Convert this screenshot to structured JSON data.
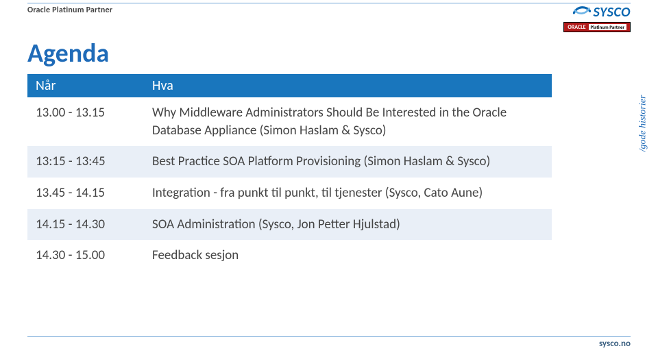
{
  "header": {
    "tagline": "Oracle Platinum Partner",
    "logo_text": "SYSCO",
    "oracle_badge_left": "ORACLE",
    "oracle_badge_right": "Platinum Partner"
  },
  "title": "Agenda",
  "table": {
    "columns": {
      "when": "Når",
      "what": "Hva"
    },
    "rows": [
      {
        "when": "13.00 - 13.15",
        "what": "Why Middleware Administrators Should Be Interested in the Oracle Database Appliance (Simon Haslam & Sysco)"
      },
      {
        "when": "13:15 - 13:45",
        "what": "Best Practice SOA Platform Provisioning (Simon Haslam & Sysco)"
      },
      {
        "when": "13.45 - 14.15",
        "what": "Integration - fra punkt til punkt, til tjenester (Sysco, Cato Aune)"
      },
      {
        "when": "14.15 - 14.30",
        "what": "SOA Administration (Sysco, Jon Petter Hjulstad)"
      },
      {
        "when": "14.30 - 15.00",
        "what": "Feedback sesjon"
      }
    ]
  },
  "ribbon": "/gode historier",
  "footer": {
    "url": "sysco.no"
  },
  "colors": {
    "brand_blue": "#1f6bb8",
    "header_blue": "#1976bd",
    "row_tint": "#e9eff7",
    "oracle_red": "#b31b1b"
  }
}
